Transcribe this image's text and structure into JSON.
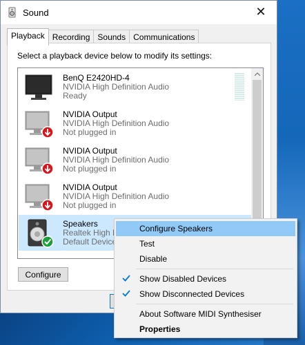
{
  "window": {
    "title": "Sound",
    "close_glyph": "✕"
  },
  "tabs": [
    {
      "label": "Playback",
      "active": true
    },
    {
      "label": "Recording"
    },
    {
      "label": "Sounds"
    },
    {
      "label": "Communications"
    }
  ],
  "instruction": "Select a playback device below to modify its settings:",
  "devices": [
    {
      "name": "BenQ E2420HD-4",
      "driver": "NVIDIA High Definition Audio",
      "status": "Ready",
      "icon": "monitor-icon"
    },
    {
      "name": "NVIDIA Output",
      "driver": "NVIDIA High Definition Audio",
      "status": "Not plugged in",
      "icon": "monitor-unplugged-icon"
    },
    {
      "name": "NVIDIA Output",
      "driver": "NVIDIA High Definition Audio",
      "status": "Not plugged in",
      "icon": "monitor-unplugged-icon"
    },
    {
      "name": "NVIDIA Output",
      "driver": "NVIDIA High Definition Audio",
      "status": "Not plugged in",
      "icon": "monitor-unplugged-icon"
    },
    {
      "name": "Speakers",
      "driver": "Realtek High D",
      "status": "Default Device",
      "icon": "speaker-default-icon"
    }
  ],
  "buttons": {
    "configure": "Configure"
  },
  "context_menu": {
    "items": [
      {
        "label": "Configure Speakers",
        "highlighted": true
      },
      {
        "label": "Test"
      },
      {
        "label": "Disable"
      },
      {
        "label": "Show Disabled Devices",
        "checked": true
      },
      {
        "label": "Show Disconnected Devices",
        "checked": true
      },
      {
        "label": "About Software MIDI Synthesiser"
      },
      {
        "label": "Properties",
        "bold": true
      }
    ]
  },
  "colors": {
    "selection": "#cce8ff",
    "menu_highlight": "#91c9f7",
    "check": "#0078d7",
    "unplugged_badge": "#d9141a",
    "default_badge": "#1e9e3a"
  }
}
